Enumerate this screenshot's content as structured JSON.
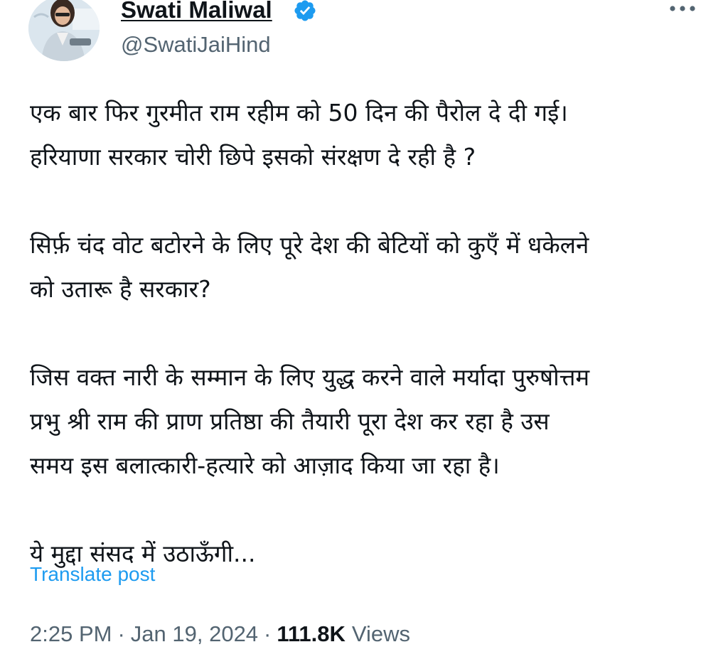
{
  "author": {
    "display_name": "Swati Maliwal",
    "handle": "@SwatiJaiHind",
    "verified": true,
    "avatar_icon": "profile-photo",
    "verified_icon": "verified-badge-icon"
  },
  "post": {
    "paragraphs": [
      {
        "lines": [
          "एक बार फिर गुरमीत राम रहीम को 50 दिन की पैरोल दे दी गई।",
          "हरियाणा सरकार चोरी छिपे इसको संरक्षण दे रही है ?"
        ]
      },
      {
        "lines": [
          "सिर्फ़ चंद वोट बटोरने के लिए पूरे देश की बेटियों को कुएँ में धकेलने",
          "को उतारू है सरकार?"
        ]
      },
      {
        "lines": [
          "जिस वक्त नारी के सम्मान के लिए युद्ध करने वाले मर्यादा पुरुषोत्तम",
          "प्रभु श्री राम की प्राण प्रतिष्ठा की तैयारी पूरा देश कर रहा है उस",
          "समय इस बलात्कारी-हत्यारे को आज़ाद किया जा रहा है।"
        ]
      },
      {
        "lines": [
          "ये मुद्दा संसद में उठाऊँगी..."
        ]
      }
    ],
    "translate_label": "Translate post"
  },
  "meta": {
    "time": "2:25 PM",
    "separator": "·",
    "date": "Jan 19, 2024",
    "views_count": "111.8K",
    "views_label": "Views"
  },
  "colors": {
    "text": "#0f1419",
    "secondary": "#536471",
    "link": "#1d9bf0",
    "verified": "#1d9bf0"
  }
}
